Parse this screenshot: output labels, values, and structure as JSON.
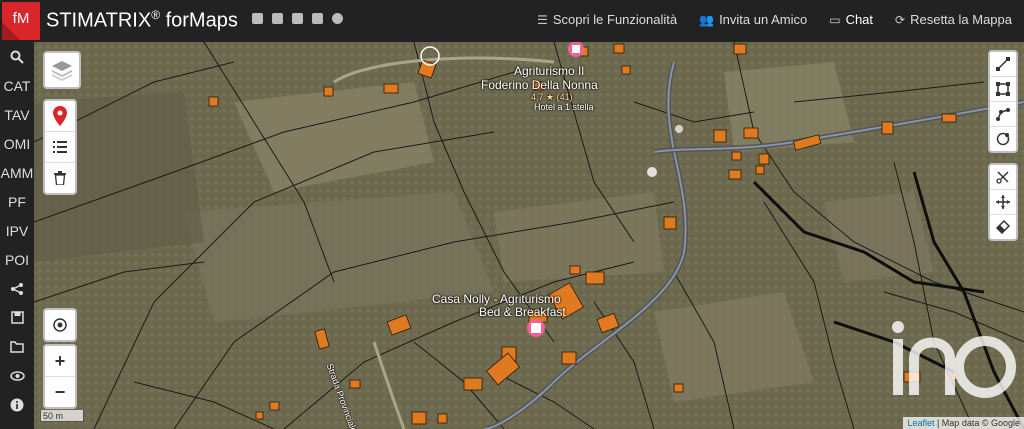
{
  "header": {
    "logo_text": "fM",
    "brand": "STIMATRIX",
    "brand_reg": "®",
    "brand_suffix": " forMaps",
    "social_icons": [
      "facebook-icon",
      "linkedin-icon",
      "youtube-icon",
      "instagram-icon",
      "extra-icon"
    ],
    "menu": [
      {
        "label": "Scopri le Funzionalità",
        "icon": "list-icon"
      },
      {
        "label": "Invita un Amico",
        "icon": "users-icon"
      },
      {
        "label": "Chat",
        "icon": "chat-icon"
      },
      {
        "label": "Resetta la Mappa",
        "icon": "refresh-icon"
      }
    ]
  },
  "sidebar": {
    "labels": [
      "CAT",
      "TAV",
      "OMI",
      "AMM",
      "PF",
      "IPV",
      "POI"
    ]
  },
  "map": {
    "labels": {
      "place1": "Agriturismo Il",
      "place2": "Foderino Della Nonna",
      "rating": "4.7 ★ (41)",
      "hotel": "Hotel a 1 stella",
      "place3": "Casa Nolly - Agriturismo",
      "place4": "Bed & Breakfast",
      "road": "Strada Provinciale"
    },
    "scale": "50 m",
    "attribution_link": "Leaflet",
    "attribution_text": " | Map data © Google",
    "zoom_in": "+",
    "zoom_out": "−"
  },
  "colors": {
    "topbar": "#222222",
    "accent": "#d9262c",
    "building": "#e07a20"
  }
}
